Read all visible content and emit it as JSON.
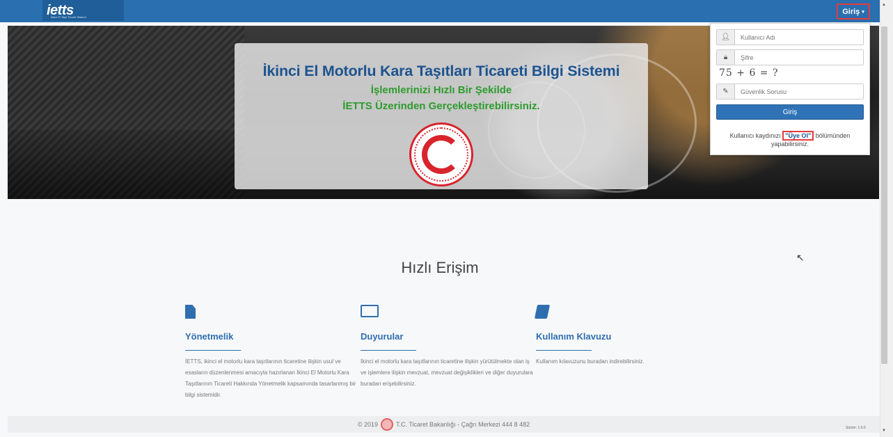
{
  "nav": {
    "logo_text": "ietts",
    "logo_subtitle": "İkinci El Taşıt Ticaret Sistemi",
    "login_menu_label": "Giriş",
    "caret": "▾"
  },
  "hero": {
    "title": "İkinci El Motorlu Kara Taşıtları Ticareti Bilgi Sistemi",
    "subtitle_line1": "İşlemlerinizi Hızlı Bir Şekilde",
    "subtitle_line2": "İETTS Üzerinden Gerçekleştirebilirsiniz."
  },
  "login": {
    "username_placeholder": "Kullanıcı Adı",
    "password_placeholder": "Şifre",
    "captcha_text": "75 + 6 = ?",
    "security_placeholder": "Güvenlik Sorusu",
    "submit_label": "Giriş",
    "register_prefix": "Kullanıcı kaydınızı ",
    "register_link": "\"Üye Ol\"",
    "register_suffix": " bölümünden yapabilirsiniz."
  },
  "quick_access": {
    "title": "Hızlı Erişim",
    "cards": [
      {
        "icon": "document-icon",
        "title": "Yönetmelik",
        "text": "İETTS, ikinci el motorlu kara taşıtlarının ticaretine ilişkin usul ve esasların düzenlenmesi amacıyla hazırlanan İkinci El Motorlu Kara Taşıtlarının Ticareti Hakkında Yönetmelik kapsamında tasarlanmış bir bilgi sistemidir."
      },
      {
        "icon": "newspaper-icon",
        "title": "Duyurular",
        "text": "İkinci el motorlu kara taşıtlarının ticaretine ilişkin yürütülmekte olan iş ve işlemlere ilişkin mevzuat, mevzuat değişiklikleri ve diğer duyurulara buradan erişebilirsiniz."
      },
      {
        "icon": "book-icon",
        "title": "Kullanım Klavuzu",
        "text": "Kullanım kılavuzunu buradan indirebilirsiniz."
      }
    ]
  },
  "footer": {
    "year": "© 2019",
    "text": "T.C. Ticaret Bakanlığı - Çağrı Merkezi 444 8 482",
    "version": "Sürüm: 1.0.0"
  }
}
